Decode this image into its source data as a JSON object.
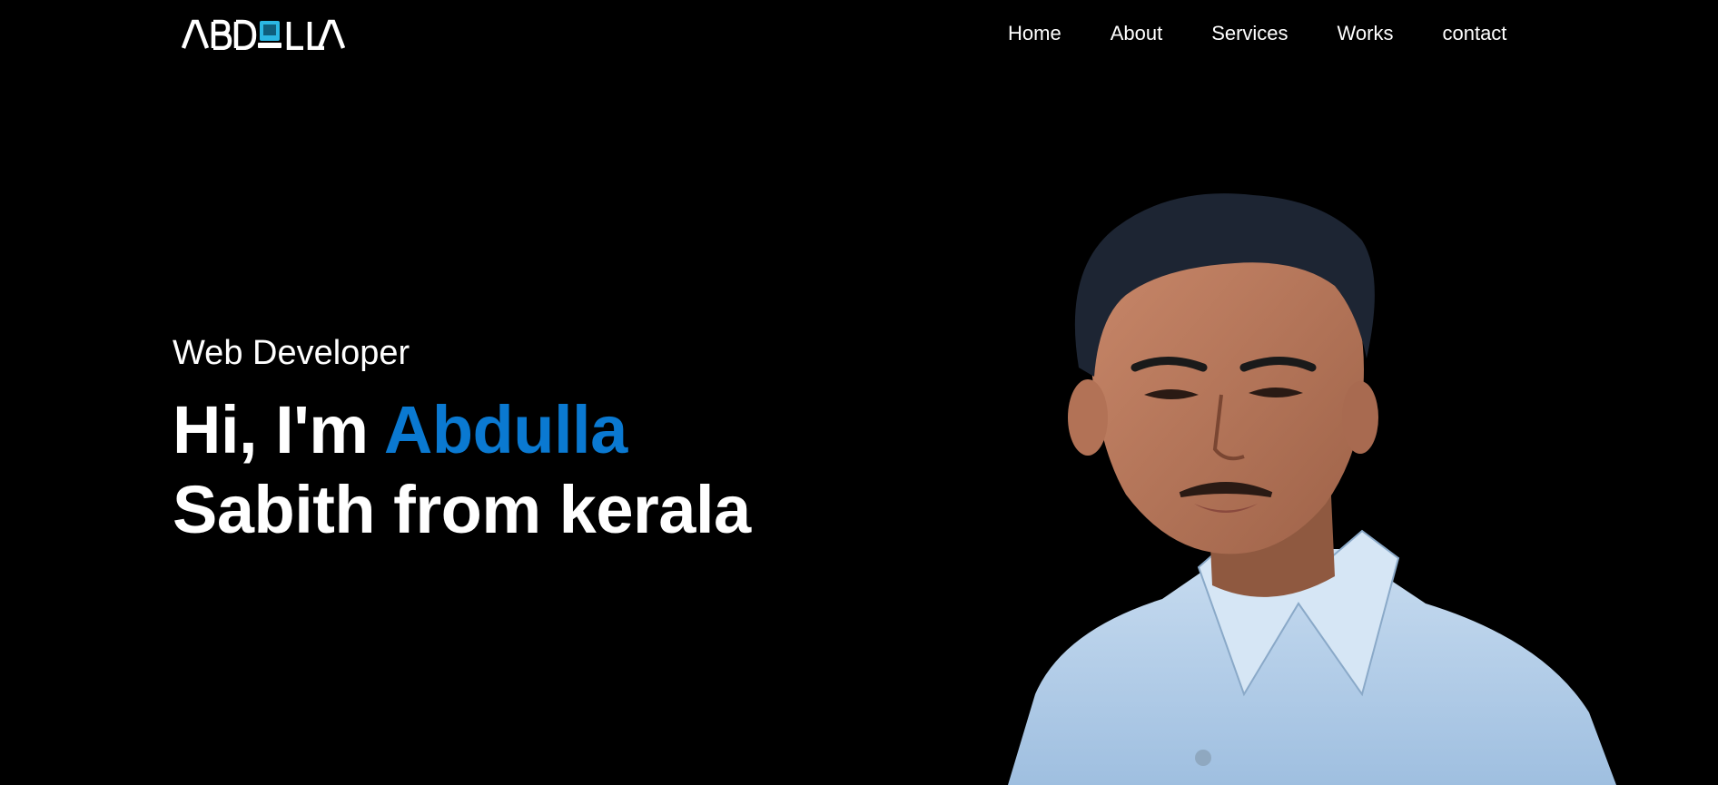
{
  "logo": {
    "letters": [
      "A",
      "B",
      "D",
      "U",
      "L",
      "L",
      "A"
    ],
    "accent_color": "#2bb7e3"
  },
  "nav": {
    "items": [
      {
        "label": "Home"
      },
      {
        "label": "About"
      },
      {
        "label": "Services"
      },
      {
        "label": "Works"
      },
      {
        "label": "contact"
      }
    ]
  },
  "hero": {
    "role": "Web Developer",
    "greeting": "Hi, I'm",
    "name": "Abdulla",
    "line2": "Sabith from kerala",
    "name_color": "#0a79d1"
  },
  "portrait": {
    "shirt_color": "#b9d3ec",
    "background": "#000000"
  }
}
